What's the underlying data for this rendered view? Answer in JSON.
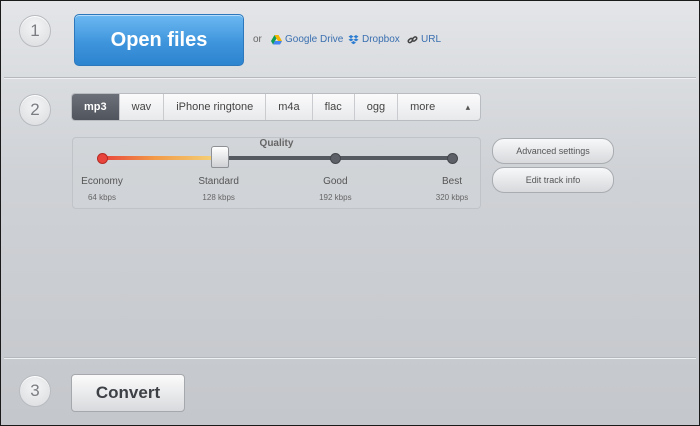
{
  "steps": {
    "one": "1",
    "two": "2",
    "three": "3"
  },
  "open_files": {
    "label": "Open files",
    "or": "or"
  },
  "sources": [
    {
      "label": "Google Drive",
      "icon": "google-drive-icon"
    },
    {
      "label": "Dropbox",
      "icon": "dropbox-icon"
    },
    {
      "label": "URL",
      "icon": "link-icon"
    }
  ],
  "formats": {
    "tabs": [
      "mp3",
      "wav",
      "iPhone ringtone",
      "m4a",
      "flac",
      "ogg"
    ],
    "more_label": "more",
    "selected": "mp3"
  },
  "quality": {
    "title": "Quality",
    "selected_index": 1,
    "levels": [
      {
        "label": "Economy",
        "rate": "64 kbps"
      },
      {
        "label": "Standard",
        "rate": "128 kbps"
      },
      {
        "label": "Good",
        "rate": "192 kbps"
      },
      {
        "label": "Best",
        "rate": "320 kbps"
      }
    ]
  },
  "buttons": {
    "advanced": "Advanced settings",
    "edit_track": "Edit track info",
    "convert": "Convert"
  },
  "colors": {
    "accent_blue": "#3f95dc",
    "active_tab": "#50545c",
    "link": "#3a6fb0"
  }
}
